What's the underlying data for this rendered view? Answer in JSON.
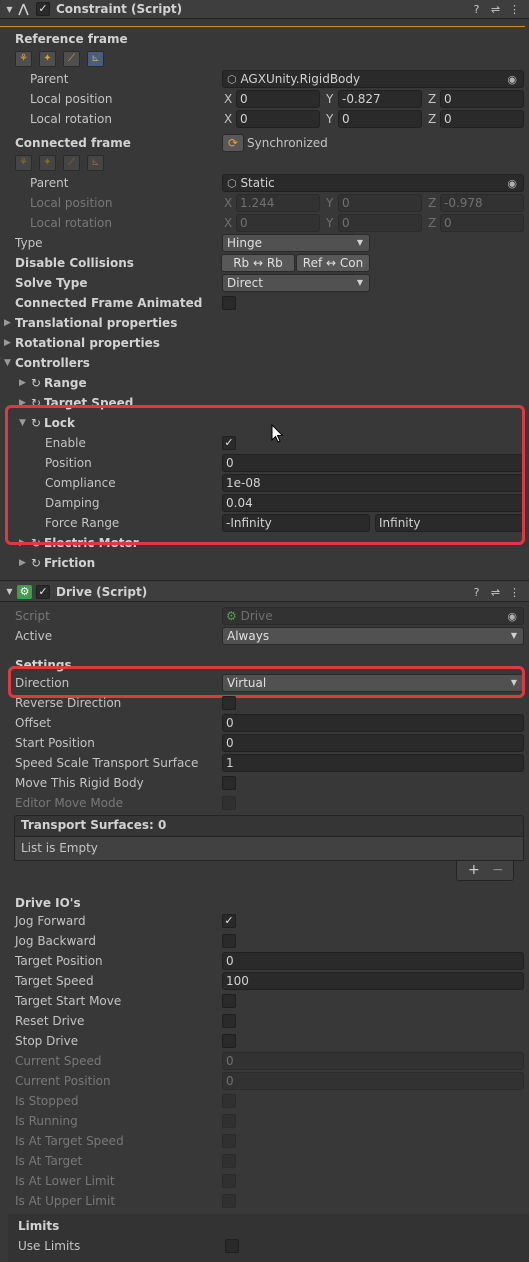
{
  "constraint": {
    "title": "Constraint (Script)",
    "reference_frame": {
      "heading": "Reference frame",
      "parent_label": "Parent",
      "parent_value": "AGXUnity.RigidBody",
      "local_position_label": "Local position",
      "local_rotation_label": "Local rotation",
      "position": {
        "x": "0",
        "y": "-0.827",
        "z": "0"
      },
      "rotation": {
        "x": "0",
        "y": "0",
        "z": "0"
      }
    },
    "connected_frame": {
      "heading": "Connected frame",
      "synchronized_label": "Synchronized",
      "parent_label": "Parent",
      "parent_value": "Static",
      "local_position_label": "Local position",
      "local_rotation_label": "Local rotation",
      "position": {
        "x": "1.244",
        "y": "0",
        "z": "-0.978"
      },
      "rotation": {
        "x": "0",
        "y": "0",
        "z": "0"
      }
    },
    "axis_labels": {
      "x": "X",
      "y": "Y",
      "z": "Z"
    },
    "type_label": "Type",
    "type_value": "Hinge",
    "disable_collisions_label": "Disable Collisions",
    "rb_rb_label": "Rb ↔ Rb",
    "ref_con_label": "Ref ↔ Con",
    "solve_type_label": "Solve Type",
    "solve_type_value": "Direct",
    "connected_frame_animated_label": "Connected Frame Animated",
    "translational_label": "Translational properties",
    "rotational_label": "Rotational properties",
    "controllers_label": "Controllers",
    "range_label": "Range",
    "target_speed_label": "Target Speed",
    "lock": {
      "label": "Lock",
      "enable_label": "Enable",
      "position_label": "Position",
      "position_value": "0",
      "compliance_label": "Compliance",
      "compliance_value": "1e-08",
      "damping_label": "Damping",
      "damping_value": "0.04",
      "force_range_label": "Force Range",
      "force_min": "-Infinity",
      "force_max": "Infinity"
    },
    "electric_motor_label": "Electric Motor",
    "friction_label": "Friction"
  },
  "drive": {
    "title": "Drive (Script)",
    "script_label": "Script",
    "script_value": "Drive",
    "active_label": "Active",
    "active_value": "Always",
    "settings_label": "Settings",
    "direction_label": "Direction",
    "direction_value": "Virtual",
    "reverse_direction_label": "Reverse Direction",
    "offset_label": "Offset",
    "offset_value": "0",
    "start_position_label": "Start Position",
    "start_position_value": "0",
    "speed_scale_label": "Speed Scale Transport Surface",
    "speed_scale_value": "1",
    "move_rigid_body_label": "Move This Rigid Body",
    "editor_move_mode_label": "Editor Move Mode",
    "transport_surfaces_label": "Transport Surfaces: 0",
    "list_empty_label": "List is Empty",
    "add_label": "+",
    "remove_label": "−",
    "drive_ios_label": "Drive IO's",
    "jog_forward_label": "Jog Forward",
    "jog_backward_label": "Jog Backward",
    "target_position_label": "Target Position",
    "target_position_value": "0",
    "target_speed_label": "Target Speed",
    "target_speed_value": "100",
    "target_start_move_label": "Target Start Move",
    "reset_drive_label": "Reset Drive",
    "stop_drive_label": "Stop Drive",
    "current_speed_label": "Current Speed",
    "current_speed_value": "0",
    "current_position_label": "Current Position",
    "current_position_value": "0",
    "is_stopped_label": "Is Stopped",
    "is_running_label": "Is Running",
    "is_at_target_speed_label": "Is At Target Speed",
    "is_at_target_label": "Is At Target",
    "is_at_lower_limit_label": "Is At Lower Limit",
    "is_at_upper_limit_label": "Is At Upper Limit",
    "limits_label": "Limits",
    "use_limits_label": "Use Limits"
  },
  "icons": {
    "check": "✓",
    "help": "?",
    "settings": "⇌",
    "more": "⋮",
    "fold_open": "▼",
    "fold_closed": "▶",
    "dropdown_arrow": "▼",
    "cube": "⬡",
    "picker": "◉",
    "refresh": "↻",
    "sync": "⟳"
  },
  "accent_colors": {
    "highlight_box": "#e0383e",
    "tool_icon": "#e0a030",
    "active_tool": "#46607c"
  }
}
